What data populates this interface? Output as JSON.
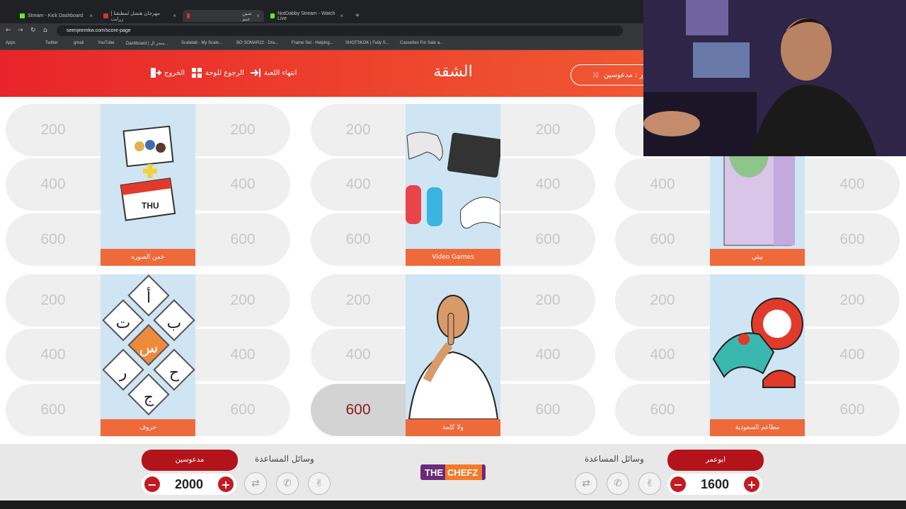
{
  "browser": {
    "tabs": [
      {
        "title": "Stream - Kick Dashboard",
        "color": "#53fc18"
      },
      {
        "title": "مهرجان هتشل لمطبقنا | زرايت",
        "color": "#e03030"
      },
      {
        "title": "سين جيم",
        "color": "#e03030"
      },
      {
        "title": "NotDabby Stream - Watch Live",
        "color": "#53fc18"
      }
    ],
    "url": "seenjeemkw.com/score-page",
    "bookmarks": [
      "Apps",
      "Twitter",
      "gmail",
      "YouTube",
      "Dashboard | متجر ال...",
      "Scalelab - My Scale...",
      "BO SOMAR22 - Dra...",
      "Frame Set - Helping...",
      "SHOTSKOK | Fully S...",
      "Cassettes For Sale a..."
    ]
  },
  "header": {
    "title": "الشقة",
    "end_game": "انتهاء اللعبة",
    "back_to_board": "الرجوع للوحة",
    "exit": "الخروج",
    "turn": "دور : مدعوسين"
  },
  "board": {
    "categories": [
      {
        "label": "خمن الصوره",
        "icon": "photos-calendar-icon"
      },
      {
        "label": "Video Games",
        "icon": "game-controllers-icon"
      },
      {
        "label": "بيتي",
        "icon": "monster-door-icon"
      },
      {
        "label": "حروف",
        "icon": "letters-grid-icon"
      },
      {
        "label": "ولا كلمة",
        "icon": "shush-man-icon"
      },
      {
        "label": "مطاعم السعودية",
        "icon": "restaurant-food-icon"
      }
    ],
    "points": [
      "200",
      "400",
      "600"
    ],
    "picked": {
      "column": 1,
      "row": 1,
      "side": "left",
      "value": "600"
    }
  },
  "footer": {
    "aids_title": "وسائل المساعدة",
    "brand_a": "THE",
    "brand_b": "CHEFZ",
    "teams": [
      {
        "name": "مدعوسين",
        "score": "2000"
      },
      {
        "name": "ابوعمر",
        "score": "1600"
      }
    ]
  },
  "colors": {
    "brand_red": "#e8242a",
    "card_orange": "#ef6a3b",
    "team_red": "#b3141b"
  }
}
